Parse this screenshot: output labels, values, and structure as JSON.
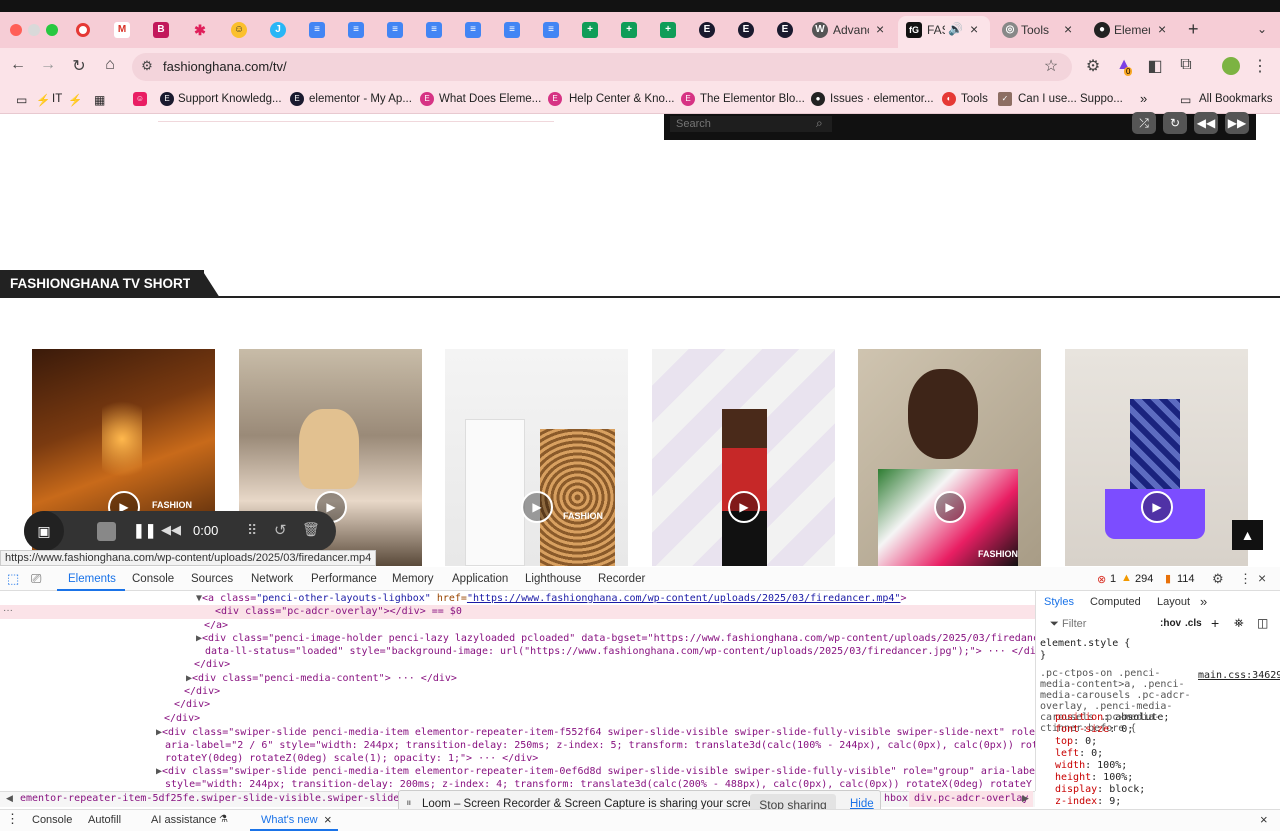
{
  "browser": {
    "tabs": [
      {
        "label": "Advanc"
      },
      {
        "label": "FAS"
      },
      {
        "label": "Tools"
      },
      {
        "label": "Elemen"
      }
    ],
    "url": "fashionghana.com/tv/",
    "profile_badge": "0"
  },
  "bookmarks": {
    "items": [
      {
        "label": "IT"
      },
      {
        "label": "Support Knowledg..."
      },
      {
        "label": "elementor - My Ap..."
      },
      {
        "label": "What Does Eleme..."
      },
      {
        "label": "Help Center & Kno..."
      },
      {
        "label": "The Elementor Blo..."
      },
      {
        "label": "Issues · elementor..."
      },
      {
        "label": "Tools"
      },
      {
        "label": "Can I use... Suppo..."
      }
    ],
    "more": "»",
    "all_bookmarks": "All Bookmarks"
  },
  "page": {
    "search_placeholder": "Search",
    "section_title": "FASHIONGHANA TV SHORTS",
    "watermark": "FASHION",
    "status_url": "https://www.fashionghana.com/wp-content/uploads/2025/03/firedancer.mp4"
  },
  "loom": {
    "time": "0:00",
    "share_message": "Loom – Screen Recorder & Screen Capture is sharing your screen.",
    "stop_label": "Stop sharing",
    "hide_label": "Hide"
  },
  "devtools": {
    "tabs": [
      "Elements",
      "Console",
      "Sources",
      "Network",
      "Performance",
      "Memory",
      "Application",
      "Lighthouse",
      "Recorder"
    ],
    "errors": "1",
    "warnings": "294",
    "issues": "114",
    "styles_tabs": [
      "Styles",
      "Computed",
      "Layout"
    ],
    "filter_placeholder": "Filter",
    "hov": ":hov",
    "cls": ".cls",
    "code_lines": {
      "l1_tag": "<a class=",
      "l1_class": "\"penci-other-layouts-lighbox\"",
      "l1_href_attr": " href=",
      "l1_href": "\"https://www.fashionghana.com/wp-content/uploads/2025/03/firedancer.mp4\"",
      "l2": "<div class=\"pc-adcr-overlay\"></div> == $0",
      "l3": "</a>",
      "l4": "<div class=\"penci-image-holder penci-lazy lazyloaded pcloaded\" data-bgset=\"https://www.fashionghana.com/wp-content/uploads/2025/03/firedancer.jpg\"",
      "l5": "data-ll-status=\"loaded\" style=\"background-image: url(\"https://www.fashionghana.com/wp-content/uploads/2025/03/firedancer.jpg\");\"> ··· </div>",
      "l6": "</div>",
      "l7": "<div class=\"penci-media-content\"> ··· </div>",
      "l8": "</div>",
      "l9": "</div>",
      "l10": "</div>",
      "l11": "<div class=\"swiper-slide penci-media-item elementor-repeater-item-f552f64 swiper-slide-visible swiper-slide-fully-visible swiper-slide-next\" role=\"group\"",
      "l12": "aria-label=\"2 / 6\" style=\"width: 244px; transition-delay: 250ms; z-index: 5; transform: translate3d(calc(100% - 244px), calc(0px), calc(0px)) rotateX(0deg)",
      "l13": "rotateY(0deg) rotateZ(0deg) scale(1); opacity: 1;\"> ··· </div>",
      "l14": "<div class=\"swiper-slide penci-media-item elementor-repeater-item-0ef6d8d swiper-slide-visible swiper-slide-fully-visible\" role=\"group\" aria-label=\"3 / 6\"",
      "l15": "style=\"width: 244px; transition-delay: 200ms; z-index: 4; transform: translate3d(calc(200% - 488px), calc(0px), calc(0px)) rotateX(0deg) rotateY(0deg) rota"
    },
    "styles": {
      "element_style": "element.style {",
      "close": "}",
      "rule_selector": ".pc-ctpos-on .penci-media-content>a, .penci-media-carousels .pc-adcr-overlay, .penci-media-carousels .pc-media-ctinner:before {",
      "source": "main.css:34629",
      "props": [
        {
          "name": "position",
          "value": "absolute;"
        },
        {
          "name": "font-size",
          "value": "0;"
        },
        {
          "name": "top",
          "value": "0;"
        },
        {
          "name": "left",
          "value": "0;"
        },
        {
          "name": "width",
          "value": "100%;"
        },
        {
          "name": "height",
          "value": "100%;"
        },
        {
          "name": "display",
          "value": "block;"
        },
        {
          "name": "z-index",
          "value": "9;"
        }
      ]
    },
    "breadcrumb_left": "ementor-repeater-item-5df25fe.swiper-slide-visible.swiper-slide-fully-visible.acti",
    "breadcrumb_right1": "hbox",
    "breadcrumb_right2": "div.pc-adcr-overlay",
    "drawer_tabs": [
      "Console",
      "Autofill",
      "AI assistance",
      "What's new"
    ]
  },
  "colors": {
    "tab_strip": "#f6cdd6",
    "toolbar": "#fbe3e8",
    "section_dark": "#222222"
  }
}
